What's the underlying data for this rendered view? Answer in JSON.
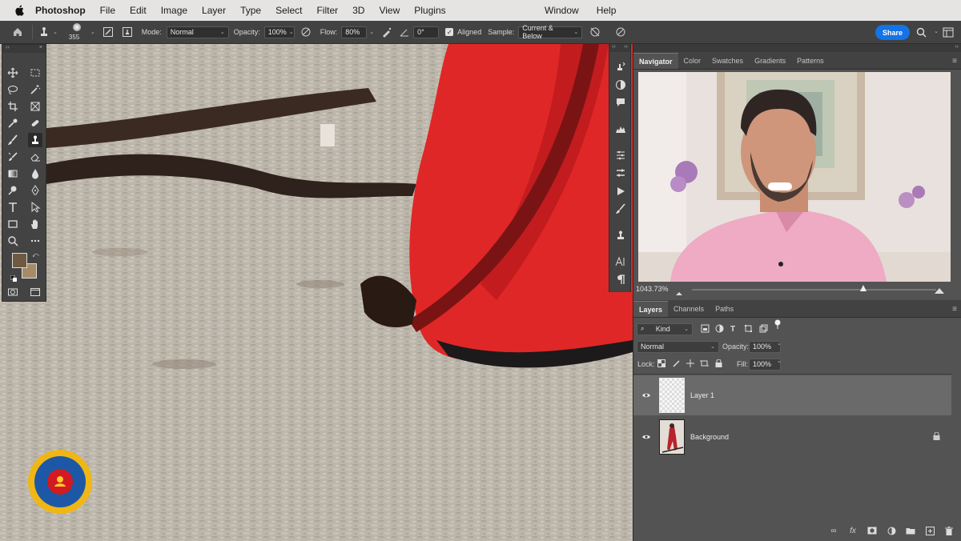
{
  "menubar": {
    "app_name": "Photoshop",
    "items": [
      "File",
      "Edit",
      "Image",
      "Layer",
      "Type",
      "Select",
      "Filter",
      "3D",
      "View",
      "Plugins"
    ],
    "right_items": [
      "Window",
      "Help"
    ]
  },
  "options_bar": {
    "brush_size": "355",
    "mode_label": "Mode:",
    "mode_value": "Normal",
    "opacity_label": "Opacity:",
    "opacity_value": "100%",
    "flow_label": "Flow:",
    "flow_value": "80%",
    "angle_value": "0°",
    "aligned_label": "Aligned",
    "aligned_checked": true,
    "sample_label": "Sample:",
    "sample_value": "Current & Below",
    "share_label": "Share"
  },
  "navigator": {
    "tabs": [
      "Navigator",
      "Color",
      "Swatches",
      "Gradients",
      "Patterns"
    ],
    "active_tab": "Navigator",
    "zoom_text": "1043.73%",
    "zoom_slider_fraction": 0.7
  },
  "layers_panel": {
    "tabs": [
      "Layers",
      "Channels",
      "Paths"
    ],
    "active_tab": "Layers",
    "filter_value": "Kind",
    "blend_mode": "Normal",
    "opacity_label": "Opacity:",
    "opacity_value": "100%",
    "lock_label": "Lock:",
    "fill_label": "Fill:",
    "fill_value": "100%",
    "layers": [
      {
        "name": "Layer 1",
        "selected": true,
        "locked": false
      },
      {
        "name": "Background",
        "selected": false,
        "locked": true
      }
    ]
  },
  "colors": {
    "accent": "#1473e6",
    "foreground_swatch": "#6e5a40",
    "background_swatch": "#a58b68",
    "panel_bg": "#535353"
  },
  "icons": {
    "tools": [
      "move-icon",
      "marquee-icon",
      "lasso-icon",
      "magic-wand-icon",
      "crop-icon",
      "frame-icon",
      "eyedropper-icon",
      "healing-brush-icon",
      "brush-icon",
      "clone-stamp-icon",
      "history-brush-icon",
      "eraser-icon",
      "gradient-icon",
      "blur-icon",
      "dodge-icon",
      "pen-icon",
      "type-icon",
      "path-select-icon",
      "rectangle-icon",
      "hand-icon",
      "zoom-icon",
      "more-tools-icon"
    ]
  }
}
